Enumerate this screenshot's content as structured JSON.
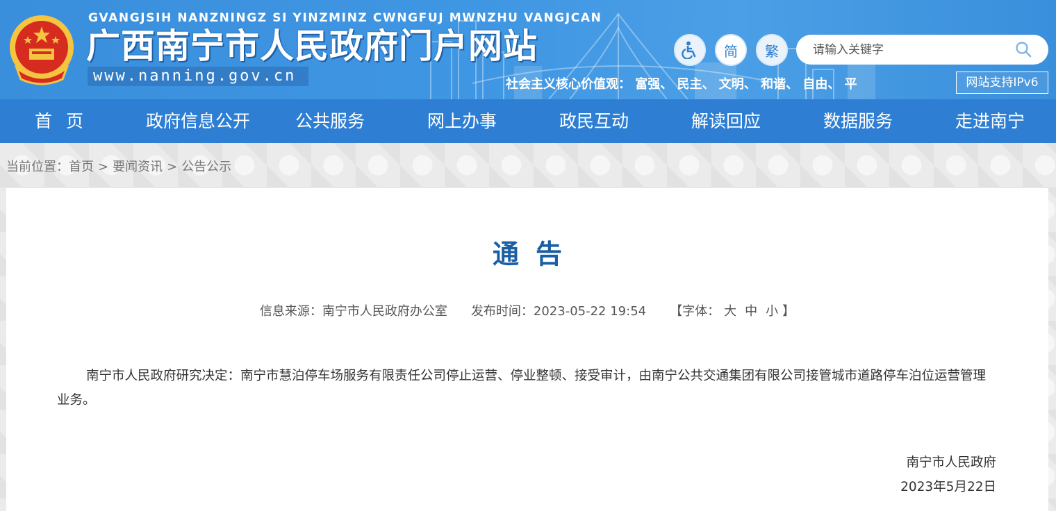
{
  "header": {
    "pinyin": "GVANGJSIH NANZNINGZ SI YINZMINZ CWNGFUJ MWNZHU VANGJCAN",
    "site_title": "广西南宁市人民政府门户网站",
    "domain": "www.nanning.gov.cn",
    "accessibility_icon": "wheelchair-icon",
    "simplified_label": "简",
    "traditional_label": "繁",
    "search_placeholder": "请输入关键字",
    "core_values": "社会主义核心价值观：  富强、  民主、  文明、  和谐、  自由、  平",
    "ipv6_label": "网站支持IPv6"
  },
  "nav": [
    "首页",
    "政府信息公开",
    "公共服务",
    "网上办事",
    "政民互动",
    "解读回应",
    "数据服务",
    "走进南宁"
  ],
  "breadcrumb": {
    "label": "当前位置：",
    "items": [
      "首页",
      "要闻资讯",
      "公告公示"
    ],
    "separator": ">"
  },
  "article": {
    "title": "通告",
    "source": "信息来源：南宁市人民政府办公室",
    "publish_time": "发布时间：2023-05-22 19:54",
    "font_label_open": "【字体：",
    "font_large": "大",
    "font_medium": "中",
    "font_small": "小",
    "font_label_close": "】",
    "body": "南宁市人民政府研究决定：南宁市慧泊停车场服务有限责任公司停止运营、停业整顿、接受审计，由南宁公共交通集团有限公司接管城市道路停车泊位运营管理业务。",
    "signature": "南宁市人民政府",
    "date": "2023年5月22日"
  },
  "colors": {
    "header_blue": "#3a8fdc",
    "nav_blue": "#2e7fd3",
    "title_blue": "#1a5fa5"
  }
}
